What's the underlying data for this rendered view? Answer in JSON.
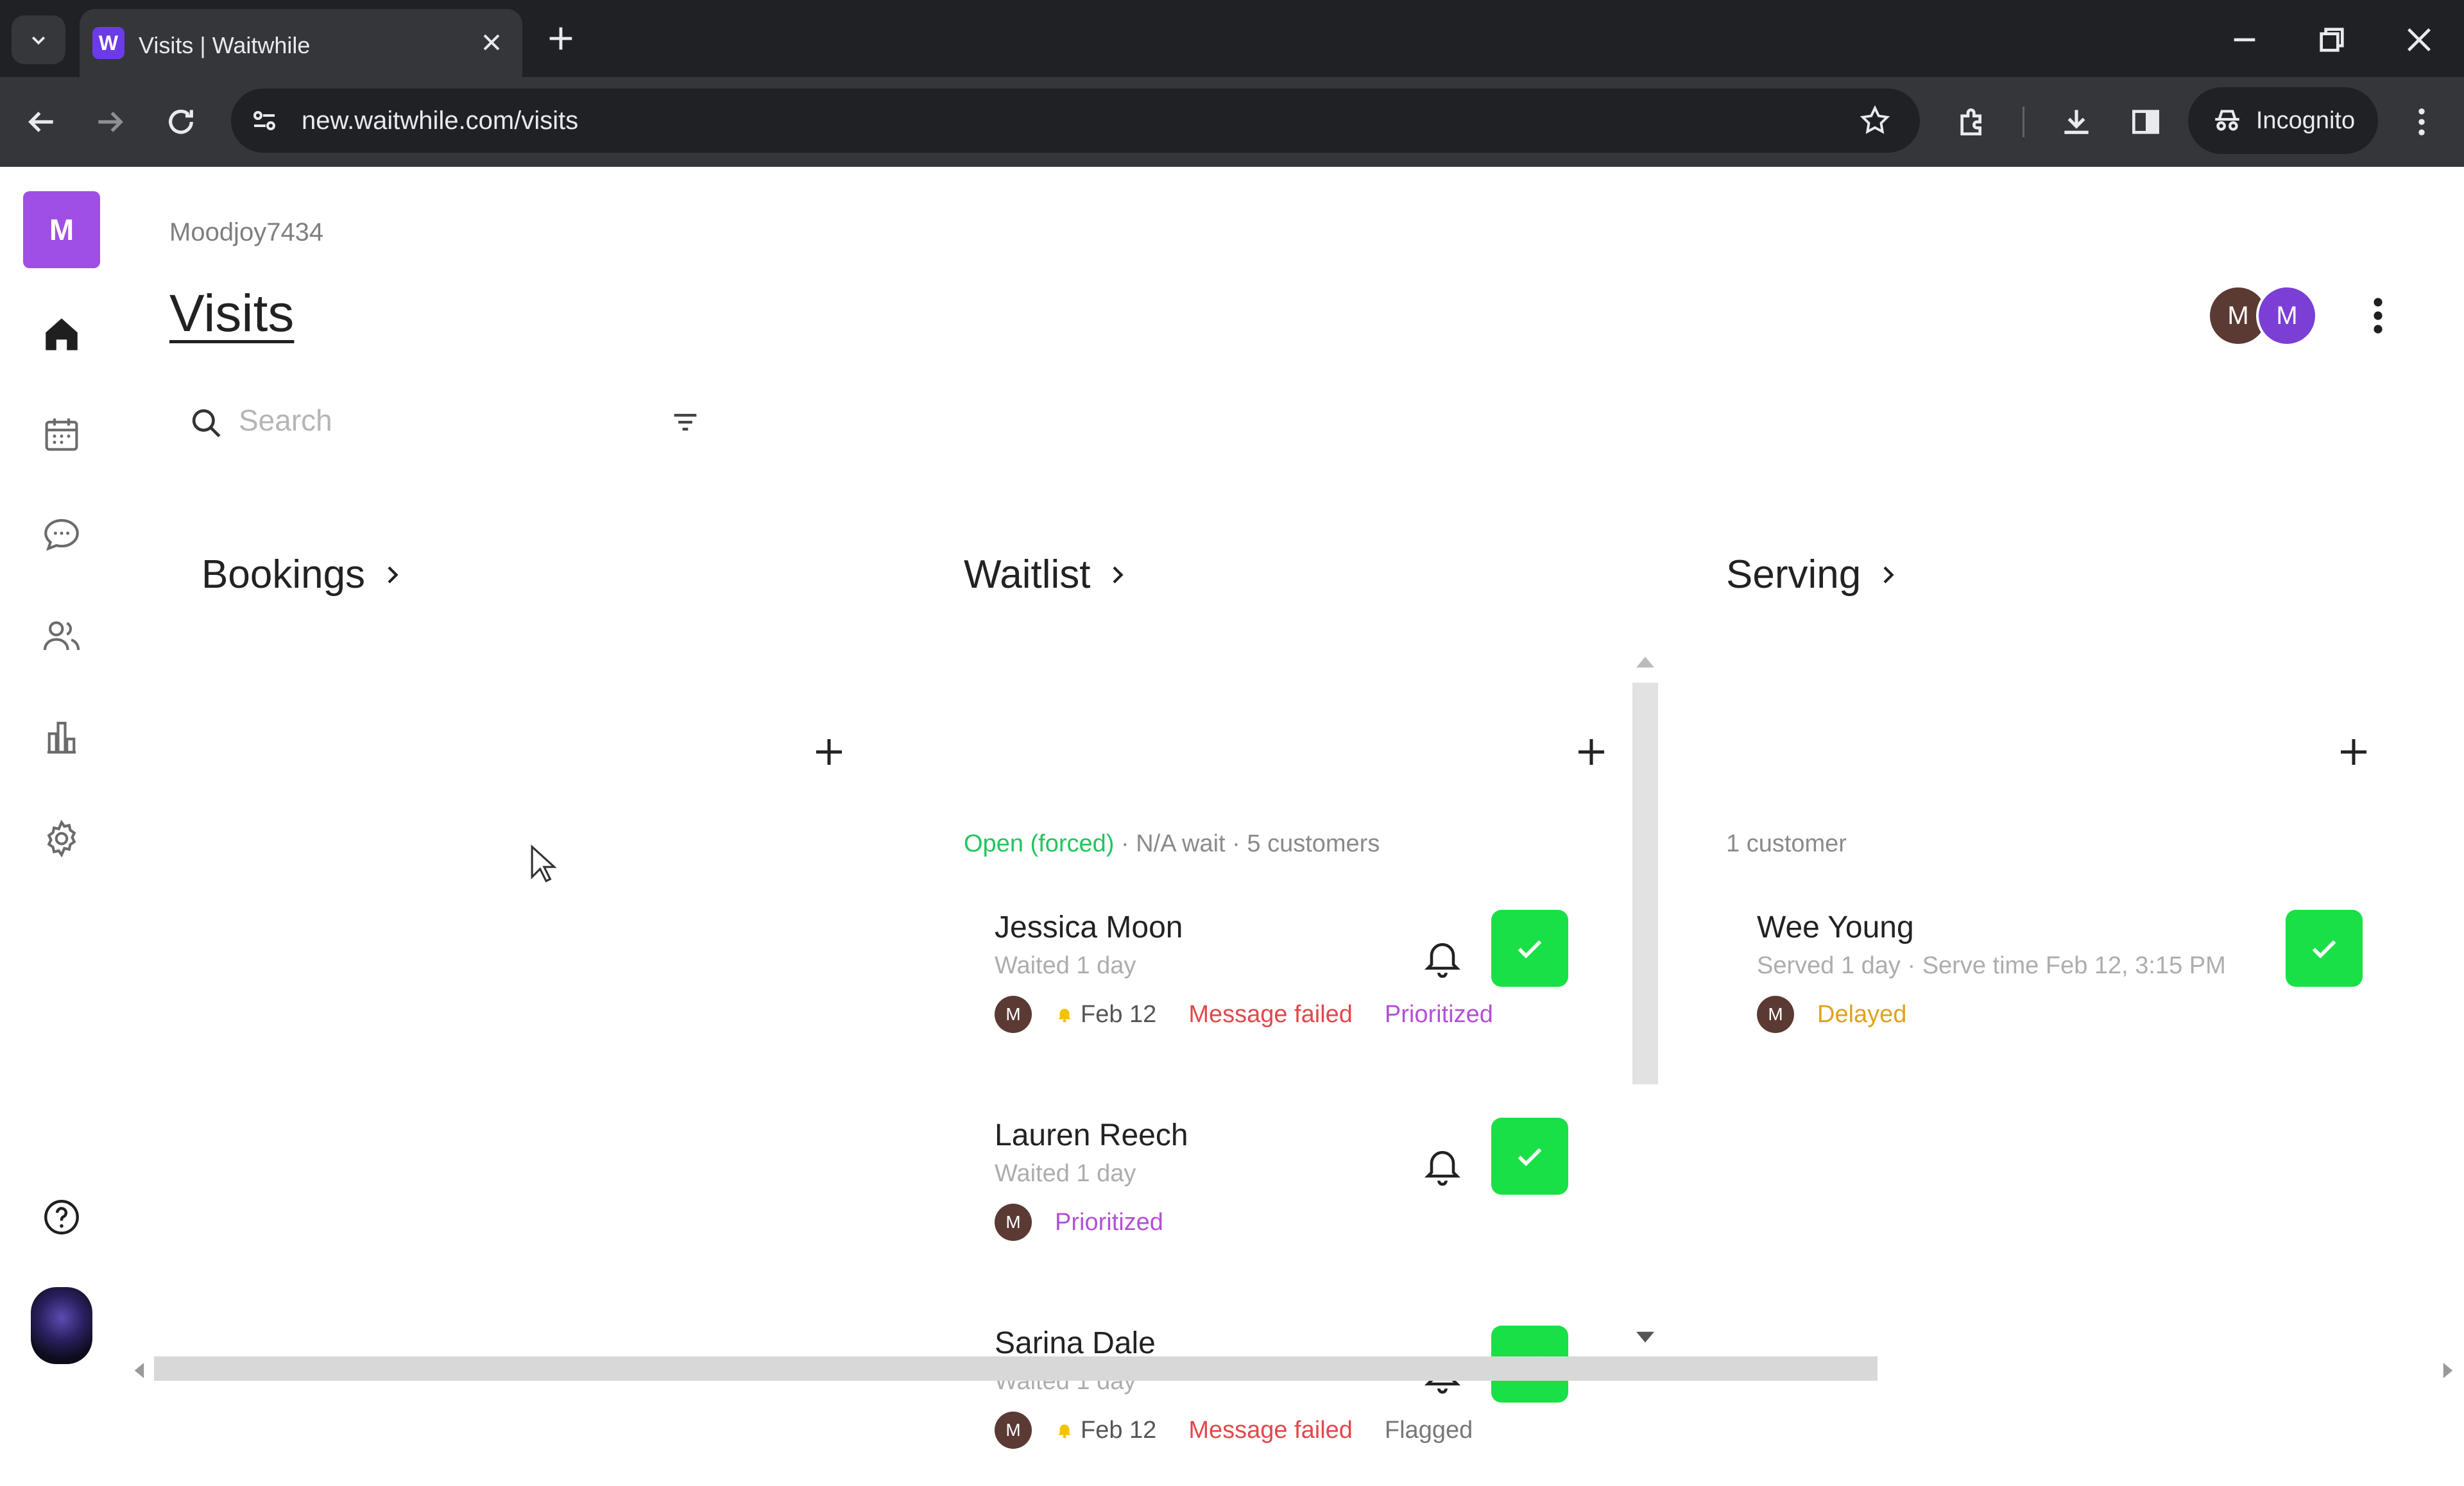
{
  "browser": {
    "tab_title": "Visits | Waitwhile",
    "favicon_letter": "W",
    "url": "new.waitwhile.com/visits",
    "incognito_label": "Incognito",
    "icons": [
      "back-icon",
      "forward-icon",
      "reload-icon",
      "site-settings-icon",
      "star-icon",
      "extensions-icon",
      "download-icon",
      "side-panel-icon",
      "incognito-icon",
      "more-icon",
      "minimize-icon",
      "restore-icon",
      "close-icon"
    ]
  },
  "sidebar": {
    "logo_letter": "M",
    "items": [
      "home-icon",
      "calendar-icon",
      "chat-icon",
      "customers-icon",
      "analytics-icon",
      "settings-icon"
    ],
    "help": "help-icon"
  },
  "header": {
    "account_name": "Moodjoy7434",
    "title": "Visits",
    "avatars": [
      {
        "letter": "M",
        "color": "#5b3a33"
      },
      {
        "letter": "M",
        "color": "#7b3fd6"
      }
    ]
  },
  "search": {
    "placeholder": "Search"
  },
  "columns": {
    "bookings": {
      "title": "Bookings"
    },
    "waitlist": {
      "title": "Waitlist",
      "status_open": "Open (forced)",
      "status_rest": " · N/A wait · 5 customers",
      "cards": [
        {
          "name": "Jessica Moon",
          "sub": "Waited 1 day",
          "avatar": "M",
          "date": "Feb 12",
          "message": "Message failed",
          "tag": "Prioritized"
        },
        {
          "name": "Lauren Reech",
          "sub": "Waited 1 day",
          "avatar": "M",
          "tag": "Prioritized"
        },
        {
          "name": "Sarina Dale",
          "sub": "Waited 1 day",
          "avatar": "M",
          "date": "Feb 12",
          "message": "Message failed",
          "tag": "Flagged"
        }
      ]
    },
    "serving": {
      "title": "Serving",
      "count_text": "1 customer",
      "cards": [
        {
          "name": "Wee Young",
          "sub": "Served 1 day · Serve time Feb 12, 3:15 PM",
          "avatar": "M",
          "tag": "Delayed"
        }
      ]
    }
  },
  "colors": {
    "brand": "#a04fe6",
    "check_green": "#19e046",
    "open_green": "#22c55e",
    "error_red": "#e2474b",
    "prioritized_purple": "#b44fd6",
    "delayed_orange": "#e0a21b"
  }
}
